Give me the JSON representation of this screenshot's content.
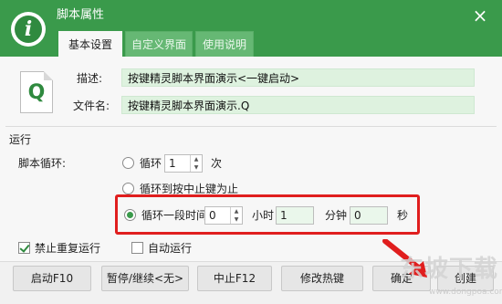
{
  "window": {
    "title": "脚本属性",
    "close_glyph": "×",
    "logo_glyph": "i"
  },
  "tabs": [
    {
      "label": "基本设置",
      "active": true
    },
    {
      "label": "自定义界面",
      "active": false
    },
    {
      "label": "使用说明",
      "active": false
    }
  ],
  "file": {
    "icon_letter": "Q",
    "description_label": "描述:",
    "description_value": "按键精灵脚本界面演示<一键启动>",
    "filename_label": "文件名:",
    "filename_value": "按键精灵脚本界面演示.Q"
  },
  "run": {
    "section_title": "运行",
    "loop_label": "脚本循环:",
    "option_loop": {
      "label": "循环",
      "count": "1",
      "unit": "次",
      "selected": false
    },
    "option_until_stop": {
      "label": "循环到按中止键为止",
      "selected": false
    },
    "option_duration": {
      "label": "循环一段时间",
      "hours": "0",
      "hours_unit": "小时",
      "minutes": "1",
      "minutes_unit": "分钟",
      "seconds": "0",
      "seconds_unit": "秒",
      "selected": true
    }
  },
  "checkboxes": {
    "no_repeat": {
      "label": "禁止重复运行",
      "checked": true
    },
    "auto_run": {
      "label": "自动运行",
      "checked": false
    }
  },
  "buttons": {
    "start": "启动F10",
    "pause": "暂停/继续<无>",
    "stop": "中止F12",
    "hotkey": "修改热键",
    "confirm": "确定",
    "create": "创建"
  },
  "watermark": {
    "text": "东坡下载",
    "url": "www.dongpoa.com"
  },
  "colors": {
    "header_green": "#3a9a4b",
    "field_green": "#def2df",
    "highlight_red": "#e01e1e"
  }
}
